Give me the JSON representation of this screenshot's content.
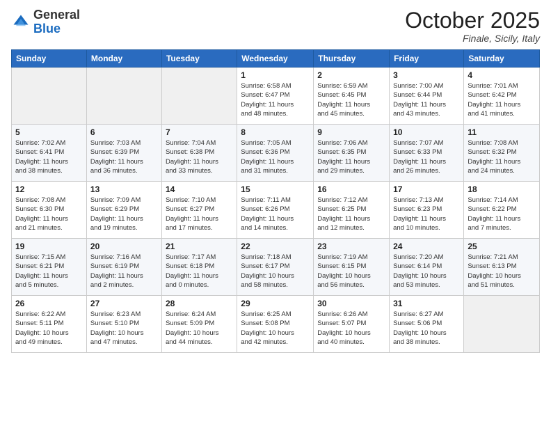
{
  "header": {
    "logo_general": "General",
    "logo_blue": "Blue",
    "month_title": "October 2025",
    "location": "Finale, Sicily, Italy"
  },
  "calendar": {
    "weekdays": [
      "Sunday",
      "Monday",
      "Tuesday",
      "Wednesday",
      "Thursday",
      "Friday",
      "Saturday"
    ],
    "weeks": [
      [
        {
          "day": "",
          "info": ""
        },
        {
          "day": "",
          "info": ""
        },
        {
          "day": "",
          "info": ""
        },
        {
          "day": "1",
          "info": "Sunrise: 6:58 AM\nSunset: 6:47 PM\nDaylight: 11 hours\nand 48 minutes."
        },
        {
          "day": "2",
          "info": "Sunrise: 6:59 AM\nSunset: 6:45 PM\nDaylight: 11 hours\nand 45 minutes."
        },
        {
          "day": "3",
          "info": "Sunrise: 7:00 AM\nSunset: 6:44 PM\nDaylight: 11 hours\nand 43 minutes."
        },
        {
          "day": "4",
          "info": "Sunrise: 7:01 AM\nSunset: 6:42 PM\nDaylight: 11 hours\nand 41 minutes."
        }
      ],
      [
        {
          "day": "5",
          "info": "Sunrise: 7:02 AM\nSunset: 6:41 PM\nDaylight: 11 hours\nand 38 minutes."
        },
        {
          "day": "6",
          "info": "Sunrise: 7:03 AM\nSunset: 6:39 PM\nDaylight: 11 hours\nand 36 minutes."
        },
        {
          "day": "7",
          "info": "Sunrise: 7:04 AM\nSunset: 6:38 PM\nDaylight: 11 hours\nand 33 minutes."
        },
        {
          "day": "8",
          "info": "Sunrise: 7:05 AM\nSunset: 6:36 PM\nDaylight: 11 hours\nand 31 minutes."
        },
        {
          "day": "9",
          "info": "Sunrise: 7:06 AM\nSunset: 6:35 PM\nDaylight: 11 hours\nand 29 minutes."
        },
        {
          "day": "10",
          "info": "Sunrise: 7:07 AM\nSunset: 6:33 PM\nDaylight: 11 hours\nand 26 minutes."
        },
        {
          "day": "11",
          "info": "Sunrise: 7:08 AM\nSunset: 6:32 PM\nDaylight: 11 hours\nand 24 minutes."
        }
      ],
      [
        {
          "day": "12",
          "info": "Sunrise: 7:08 AM\nSunset: 6:30 PM\nDaylight: 11 hours\nand 21 minutes."
        },
        {
          "day": "13",
          "info": "Sunrise: 7:09 AM\nSunset: 6:29 PM\nDaylight: 11 hours\nand 19 minutes."
        },
        {
          "day": "14",
          "info": "Sunrise: 7:10 AM\nSunset: 6:27 PM\nDaylight: 11 hours\nand 17 minutes."
        },
        {
          "day": "15",
          "info": "Sunrise: 7:11 AM\nSunset: 6:26 PM\nDaylight: 11 hours\nand 14 minutes."
        },
        {
          "day": "16",
          "info": "Sunrise: 7:12 AM\nSunset: 6:25 PM\nDaylight: 11 hours\nand 12 minutes."
        },
        {
          "day": "17",
          "info": "Sunrise: 7:13 AM\nSunset: 6:23 PM\nDaylight: 11 hours\nand 10 minutes."
        },
        {
          "day": "18",
          "info": "Sunrise: 7:14 AM\nSunset: 6:22 PM\nDaylight: 11 hours\nand 7 minutes."
        }
      ],
      [
        {
          "day": "19",
          "info": "Sunrise: 7:15 AM\nSunset: 6:21 PM\nDaylight: 11 hours\nand 5 minutes."
        },
        {
          "day": "20",
          "info": "Sunrise: 7:16 AM\nSunset: 6:19 PM\nDaylight: 11 hours\nand 2 minutes."
        },
        {
          "day": "21",
          "info": "Sunrise: 7:17 AM\nSunset: 6:18 PM\nDaylight: 11 hours\nand 0 minutes."
        },
        {
          "day": "22",
          "info": "Sunrise: 7:18 AM\nSunset: 6:17 PM\nDaylight: 10 hours\nand 58 minutes."
        },
        {
          "day": "23",
          "info": "Sunrise: 7:19 AM\nSunset: 6:15 PM\nDaylight: 10 hours\nand 56 minutes."
        },
        {
          "day": "24",
          "info": "Sunrise: 7:20 AM\nSunset: 6:14 PM\nDaylight: 10 hours\nand 53 minutes."
        },
        {
          "day": "25",
          "info": "Sunrise: 7:21 AM\nSunset: 6:13 PM\nDaylight: 10 hours\nand 51 minutes."
        }
      ],
      [
        {
          "day": "26",
          "info": "Sunrise: 6:22 AM\nSunset: 5:11 PM\nDaylight: 10 hours\nand 49 minutes."
        },
        {
          "day": "27",
          "info": "Sunrise: 6:23 AM\nSunset: 5:10 PM\nDaylight: 10 hours\nand 47 minutes."
        },
        {
          "day": "28",
          "info": "Sunrise: 6:24 AM\nSunset: 5:09 PM\nDaylight: 10 hours\nand 44 minutes."
        },
        {
          "day": "29",
          "info": "Sunrise: 6:25 AM\nSunset: 5:08 PM\nDaylight: 10 hours\nand 42 minutes."
        },
        {
          "day": "30",
          "info": "Sunrise: 6:26 AM\nSunset: 5:07 PM\nDaylight: 10 hours\nand 40 minutes."
        },
        {
          "day": "31",
          "info": "Sunrise: 6:27 AM\nSunset: 5:06 PM\nDaylight: 10 hours\nand 38 minutes."
        },
        {
          "day": "",
          "info": ""
        }
      ]
    ]
  }
}
